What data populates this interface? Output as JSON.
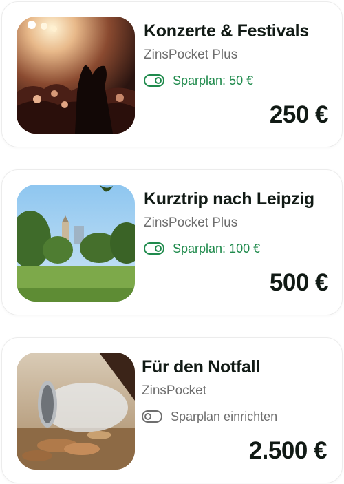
{
  "cards": [
    {
      "title": "Konzerte & Festivals",
      "product": "ZinsPocket Plus",
      "plan_label": "Sparplan: 50 €",
      "plan_active": true,
      "amount": "250 €",
      "image": "concert-crowd-photo"
    },
    {
      "title": "Kurztrip nach Leipzig",
      "product": "ZinsPocket Plus",
      "plan_label": "Sparplan: 100 €",
      "plan_active": true,
      "amount": "500 €",
      "image": "leipzig-park-photo"
    },
    {
      "title": "Für den Notfall",
      "product": "ZinsPocket",
      "plan_label": "Sparplan einrichten",
      "plan_active": false,
      "amount": "2.500 €",
      "image": "coin-jar-photo"
    }
  ],
  "colors": {
    "accent_green": "#1f8a4c",
    "text_dark": "#111a15",
    "text_muted": "#6e6e6e"
  },
  "icons": {
    "plan_on": "toggle-on-icon",
    "plan_off": "toggle-off-icon"
  }
}
